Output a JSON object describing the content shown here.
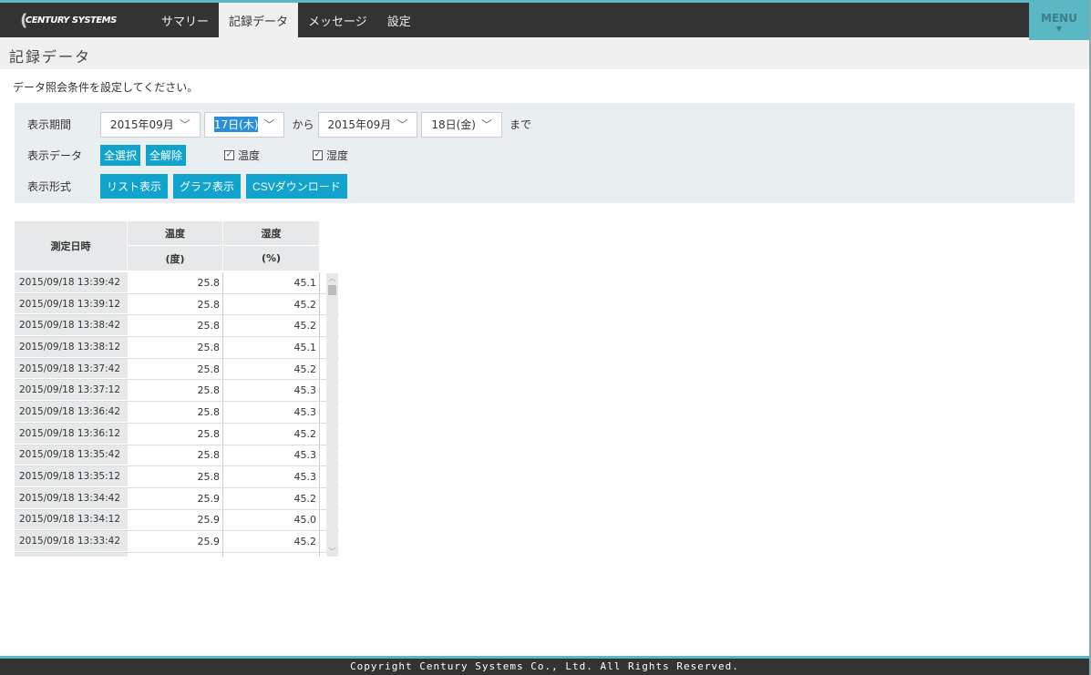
{
  "header": {
    "logo": "CENTURY SYSTEMS",
    "nav": [
      "サマリー",
      "記録データ",
      "メッセージ",
      "設定"
    ],
    "active": 1,
    "menu": "MENU"
  },
  "page": {
    "title": "記録データ",
    "instruction": "データ照会条件を設定してください。"
  },
  "filter": {
    "period_label": "表示期間",
    "from_month": "2015年09月",
    "from_day": "17日(木)",
    "from_text": "から",
    "to_month": "2015年09月",
    "to_day": "18日(金)",
    "to_text": "まで",
    "data_label": "表示データ",
    "select_all": "全選択",
    "deselect_all": "全解除",
    "checks": [
      {
        "label": "温度",
        "checked": true
      },
      {
        "label": "湿度",
        "checked": true
      }
    ],
    "format_label": "表示形式",
    "list_btn": "リスト表示",
    "graph_btn": "グラフ表示",
    "csv_btn": "CSVダウンロード"
  },
  "table": {
    "headers": {
      "datetime": "測定日時",
      "temp": "温度",
      "temp_unit": "(度)",
      "hum": "湿度",
      "hum_unit": "(%)"
    },
    "rows": [
      [
        "2015/09/18 13:39:42",
        "25.8",
        "45.1"
      ],
      [
        "2015/09/18 13:39:12",
        "25.8",
        "45.2"
      ],
      [
        "2015/09/18 13:38:42",
        "25.8",
        "45.2"
      ],
      [
        "2015/09/18 13:38:12",
        "25.8",
        "45.1"
      ],
      [
        "2015/09/18 13:37:42",
        "25.8",
        "45.2"
      ],
      [
        "2015/09/18 13:37:12",
        "25.8",
        "45.3"
      ],
      [
        "2015/09/18 13:36:42",
        "25.8",
        "45.3"
      ],
      [
        "2015/09/18 13:36:12",
        "25.8",
        "45.2"
      ],
      [
        "2015/09/18 13:35:42",
        "25.8",
        "45.3"
      ],
      [
        "2015/09/18 13:35:12",
        "25.8",
        "45.3"
      ],
      [
        "2015/09/18 13:34:42",
        "25.9",
        "45.2"
      ],
      [
        "2015/09/18 13:34:12",
        "25.9",
        "45.0"
      ],
      [
        "2015/09/18 13:33:42",
        "25.9",
        "45.2"
      ]
    ]
  },
  "footer": "Copyright Century Systems Co., Ltd. All Rights Reserved."
}
